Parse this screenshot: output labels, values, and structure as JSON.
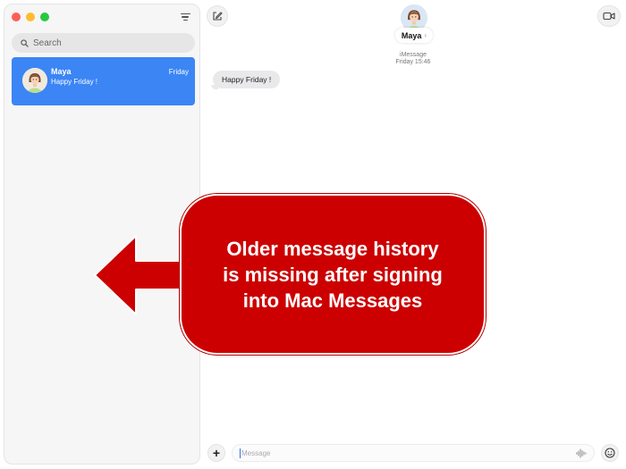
{
  "sidebar": {
    "search_placeholder": "Search",
    "conversations": [
      {
        "name": "Maya",
        "preview": "Happy Friday !",
        "time": "Friday"
      }
    ]
  },
  "header": {
    "contact_name": "Maya",
    "chevron": "›",
    "service": "iMessage",
    "timestamp": "Friday 15:46"
  },
  "thread": {
    "messages": [
      {
        "text": "Happy Friday !",
        "direction": "incoming"
      }
    ]
  },
  "composer": {
    "placeholder": "Message",
    "add_label": "+"
  },
  "annotation": {
    "lines": [
      "Older message history",
      "is missing after signing",
      "into Mac Messages"
    ],
    "color": "#cc0000"
  },
  "colors": {
    "selected_conversation": "#3b85f5",
    "incoming_bubble": "#e9e9eb"
  },
  "icons": {
    "compose": "compose-icon",
    "video": "video-camera-icon",
    "filter": "filter-icon",
    "search": "search-icon",
    "audio": "waveform-icon",
    "emoji": "emoji-icon"
  }
}
